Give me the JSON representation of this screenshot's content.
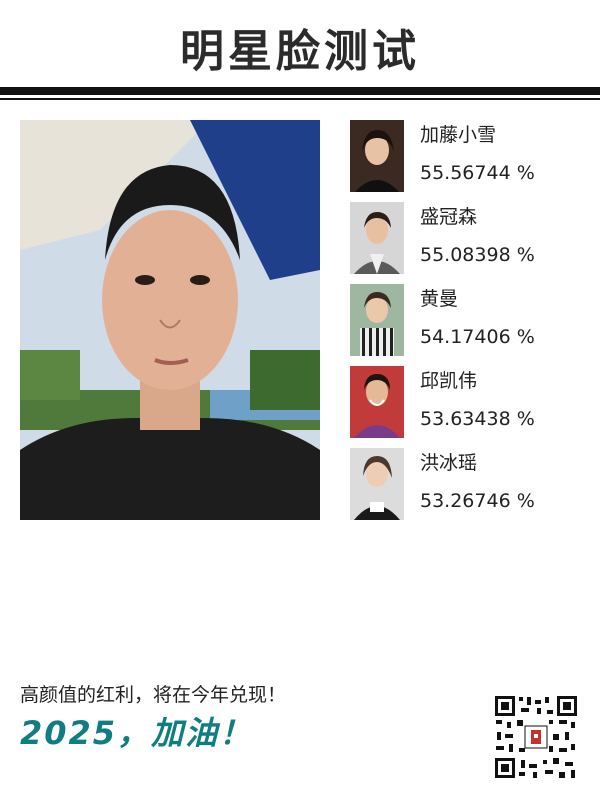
{
  "header": {
    "title": "明星脸测试"
  },
  "matches": [
    {
      "name": "加藤小雪",
      "score": "55.56744 %"
    },
    {
      "name": "盛冠森",
      "score": "55.08398 %"
    },
    {
      "name": "黄曼",
      "score": "54.17406 %"
    },
    {
      "name": "邱凯伟",
      "score": "53.63438 %"
    },
    {
      "name": "洪冰瑶",
      "score": "53.26746 %"
    }
  ],
  "footer": {
    "tagline": "高颜值的红利，将在今年兑现！",
    "slogan": "2025，加油！"
  },
  "colors": {
    "title": "#2b2b2b",
    "slogan": "#0f7d82",
    "rule": "#111111"
  }
}
